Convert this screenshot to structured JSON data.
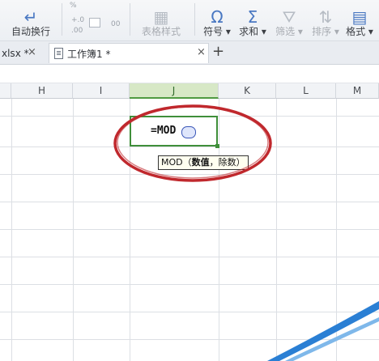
{
  "ribbon": {
    "wrap_text": "自动换行",
    "table_style": "表格样式",
    "symbol": "符号",
    "sum": "求和",
    "filter": "筛选",
    "sort": "排序",
    "format": "格式",
    "number_fmt_symbol": "%",
    "decimal_add": "+.0",
    "decimal_sub": ".00",
    "decimal_b": "00"
  },
  "tabs": [
    {
      "label": "xlsx *",
      "active": false
    },
    {
      "label": "工作簿1 *",
      "active": true
    }
  ],
  "columns": [
    "H",
    "I",
    "J",
    "K",
    "L",
    "M"
  ],
  "selected_column": "J",
  "cell": {
    "formula": "=MOD"
  },
  "tooltip": {
    "func": "MOD",
    "open": "（",
    "arg1": "数值",
    "sep": "，",
    "arg2": "除数",
    "close": "）"
  },
  "colors": {
    "annotation": "#c0282d",
    "selection": "#3f8f3a",
    "swoosh": "#2a7fd4"
  }
}
